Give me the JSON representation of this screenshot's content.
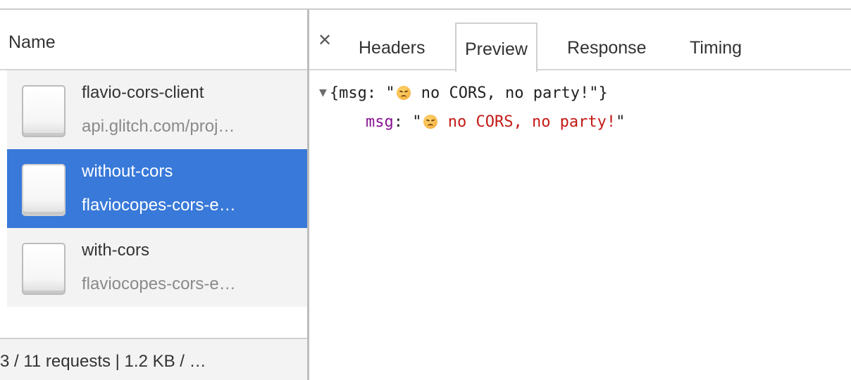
{
  "left_panel": {
    "column_header": "Name",
    "requests": [
      {
        "name": "flavio-cors-client",
        "url": "api.glitch.com/proj…",
        "selected": false
      },
      {
        "name": "without-cors",
        "url": "flaviocopes-cors-e…",
        "selected": true
      },
      {
        "name": "with-cors",
        "url": "flaviocopes-cors-e…",
        "selected": false
      }
    ],
    "status_text": "3 / 11 requests | 1.2 KB / …"
  },
  "detail_panel": {
    "close_icon": "close-icon",
    "tabs": [
      {
        "label": "Headers",
        "active": false
      },
      {
        "label": "Preview",
        "active": true
      },
      {
        "label": "Response",
        "active": false
      },
      {
        "label": "Timing",
        "active": false
      }
    ],
    "preview": {
      "summary_open": "{msg: \"",
      "summary_text": " no CORS, no party!\"}",
      "property_key": "msg",
      "property_sep": ": ",
      "property_quote_open": "\"",
      "property_value": " no CORS, no party!",
      "property_quote_close": "\"",
      "emoji": "disappointed-face-icon"
    }
  },
  "colors": {
    "selected_row": "#3879d9",
    "row_background": "#f3f3f3",
    "json_key": "#881391",
    "json_string": "#c41a16"
  }
}
